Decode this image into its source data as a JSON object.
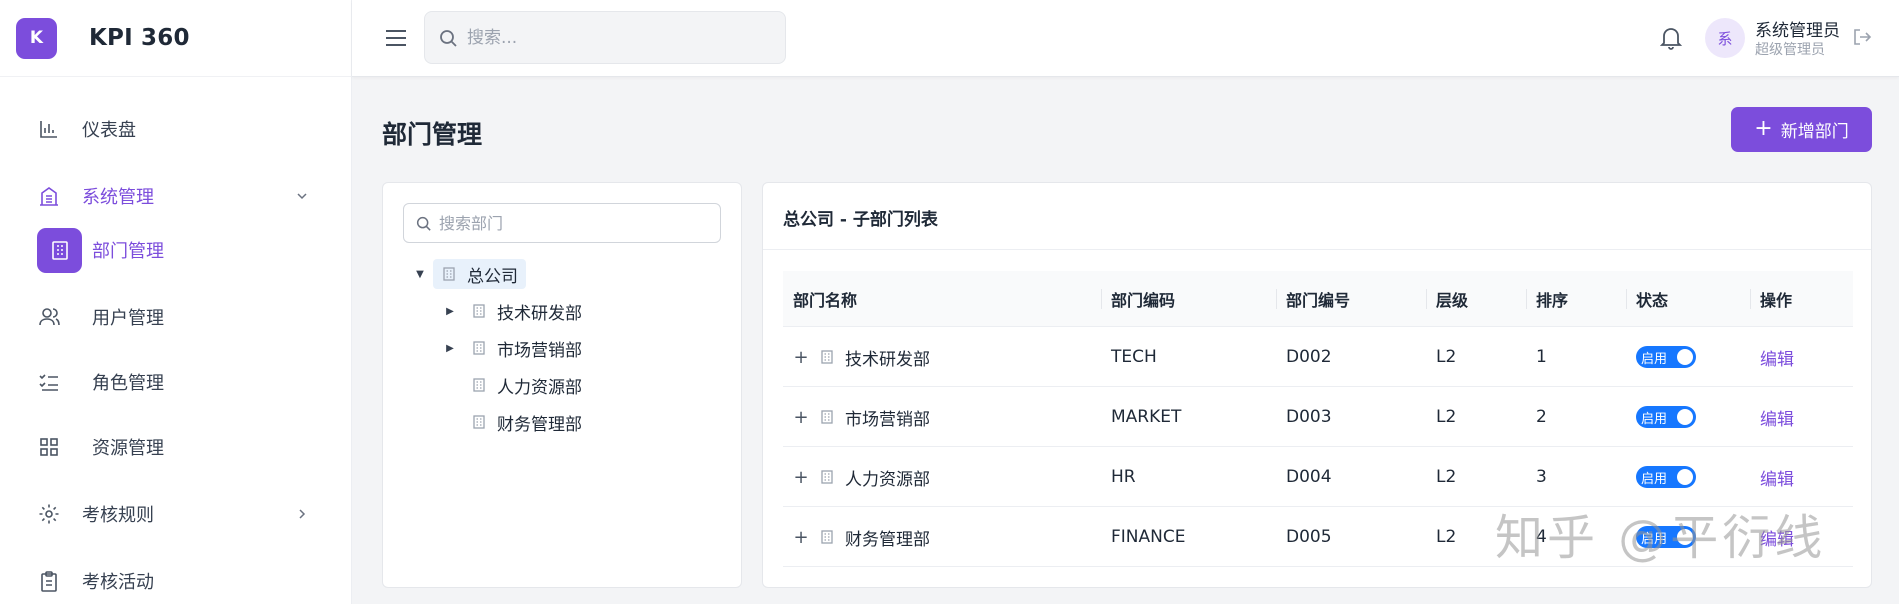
{
  "brand": {
    "logo_letter": "K",
    "name": "KPI 360",
    "accent": "#7c4ddc"
  },
  "sidebar": {
    "items": [
      {
        "label": "仪表盘",
        "icon": "bar-chart-icon"
      },
      {
        "label": "系统管理",
        "icon": "building-icon",
        "expanded": true
      },
      {
        "label": "部门管理",
        "icon": "office-icon",
        "active": true
      },
      {
        "label": "用户管理",
        "icon": "users-icon"
      },
      {
        "label": "角色管理",
        "icon": "checklist-icon"
      },
      {
        "label": "资源管理",
        "icon": "grid-icon"
      },
      {
        "label": "考核规则",
        "icon": "gear-icon"
      },
      {
        "label": "考核活动",
        "icon": "clipboard-icon"
      }
    ]
  },
  "topbar": {
    "search_placeholder": "搜索...",
    "avatar_text": "系",
    "user_name": "系统管理员",
    "user_role": "超级管理员"
  },
  "page": {
    "title": "部门管理",
    "add_button": "新增部门"
  },
  "tree": {
    "search_placeholder": "搜索部门",
    "root": "总公司",
    "children": [
      "技术研发部",
      "市场营销部",
      "人力资源部",
      "财务管理部"
    ]
  },
  "table": {
    "title": "总公司 - 子部门列表",
    "headers": [
      "部门名称",
      "部门编码",
      "部门编号",
      "层级",
      "排序",
      "状态",
      "操作"
    ],
    "rows": [
      {
        "name": "技术研发部",
        "code": "TECH",
        "number": "D002",
        "level": "L2",
        "order": "1",
        "status": "启用",
        "action": "编辑"
      },
      {
        "name": "市场营销部",
        "code": "MARKET",
        "number": "D003",
        "level": "L2",
        "order": "2",
        "status": "启用",
        "action": "编辑"
      },
      {
        "name": "人力资源部",
        "code": "HR",
        "number": "D004",
        "level": "L2",
        "order": "3",
        "status": "启用",
        "action": "编辑"
      },
      {
        "name": "财务管理部",
        "code": "FINANCE",
        "number": "D005",
        "level": "L2",
        "order": "4",
        "status": "启用",
        "action": "编辑"
      }
    ]
  },
  "watermark": "知乎 @平衍线"
}
